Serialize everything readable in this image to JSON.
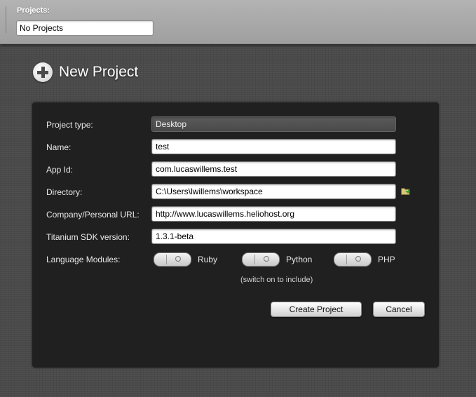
{
  "topbar": {
    "label": "Projects:",
    "selected_project": "No Projects"
  },
  "heading": {
    "title": "New Project"
  },
  "form": {
    "project_type": {
      "label": "Project type:",
      "value": "Desktop"
    },
    "name": {
      "label": "Name:",
      "value": "test"
    },
    "app_id": {
      "label": "App Id:",
      "value": "com.lucaswillems.test"
    },
    "directory": {
      "label": "Directory:",
      "value": "C:\\Users\\lwillems\\workspace"
    },
    "company_url": {
      "label": "Company/Personal URL:",
      "value": "http://www.lucaswillems.heliohost.org"
    },
    "sdk_version": {
      "label": "Titanium SDK version:",
      "value": "1.3.1-beta"
    },
    "language_modules": {
      "label": "Language Modules:",
      "modules": [
        {
          "name": "Ruby",
          "enabled": false
        },
        {
          "name": "Python",
          "enabled": false
        },
        {
          "name": "PHP",
          "enabled": false
        }
      ],
      "hint": "(switch on to include)"
    }
  },
  "buttons": {
    "create": "Create Project",
    "cancel": "Cancel"
  },
  "colors": {
    "panel_background": "#202020",
    "page_background": "#4a4a4a",
    "topbar_background": "#a8a8a8"
  },
  "icons": {
    "add": "plus-circle-icon",
    "browse": "folder-icon"
  }
}
